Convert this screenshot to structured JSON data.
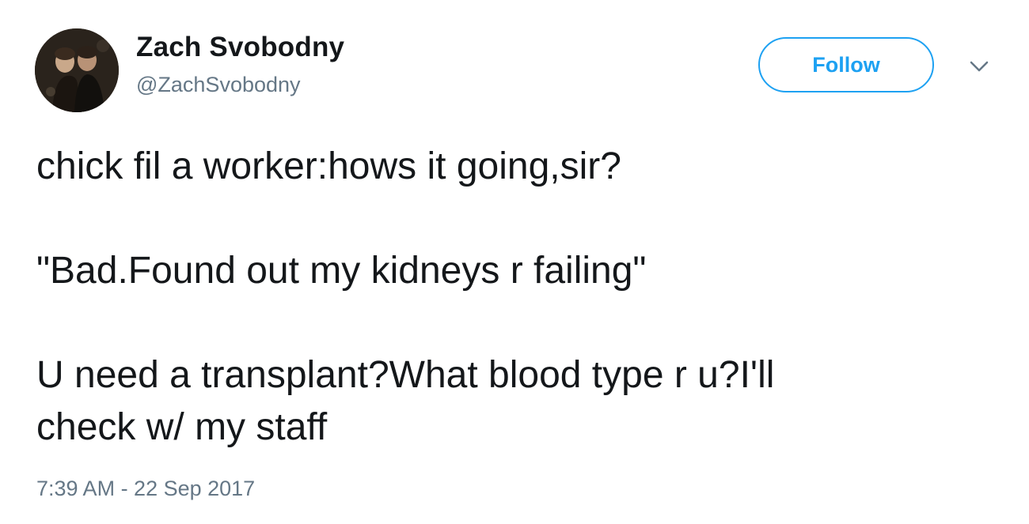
{
  "author": {
    "display_name": "Zach Svobodny",
    "handle": "@ZachSvobodny"
  },
  "actions": {
    "follow_label": "Follow",
    "menu_icon": "chevron-down-icon"
  },
  "tweet": {
    "paragraph_1": "chick fil a worker:hows it going,sir?",
    "paragraph_2": "\"Bad.Found out my kidneys r failing\"",
    "paragraph_3_line_1": "U need a transplant?What blood type r u?I'll",
    "paragraph_3_line_2": "check w/ my staff",
    "timestamp": "7:39 AM - 22 Sep 2017"
  },
  "colors": {
    "accent": "#1da1f2",
    "text": "#14171a",
    "secondary_text": "#657786"
  }
}
